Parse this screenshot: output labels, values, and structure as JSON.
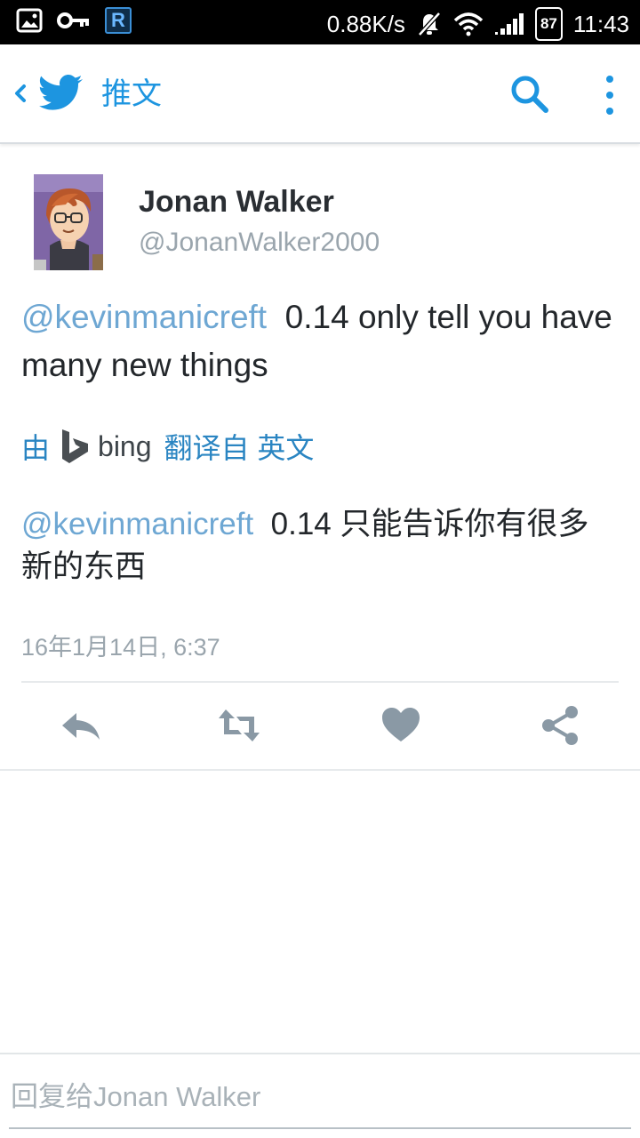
{
  "status_bar": {
    "speed": "0.88K/s",
    "battery": "87",
    "time": "11:43"
  },
  "header": {
    "title": "推文"
  },
  "tweet": {
    "author_name": "Jonan Walker",
    "author_handle": "@JonanWalker2000",
    "mention": "@kevinmanicreft",
    "text": "0.14 only tell you have many new things",
    "translation": {
      "by": "由",
      "bing": "bing",
      "from": "翻译自 英文",
      "mention": "@kevinmanicreft",
      "text": "0.14 只能告诉你有很多新的东西"
    },
    "timestamp": "16年1月14日, 6:37"
  },
  "reply": {
    "placeholder": "回复给Jonan Walker"
  },
  "colors": {
    "accent": "#1d95e0",
    "mention": "#6ea7d3",
    "action_icon": "#8a99a5"
  }
}
